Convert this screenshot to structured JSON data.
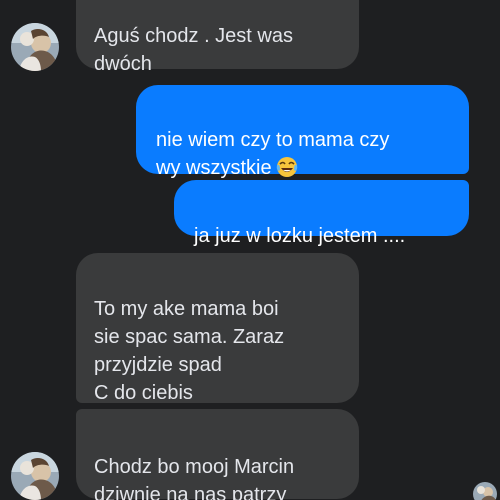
{
  "conversation": {
    "messages": [
      {
        "direction": "incoming",
        "text": "Aguś chodz . Jest was\ndwóch"
      },
      {
        "direction": "outgoing",
        "text": "nie wiem czy to mama czy\nwy wszystkie",
        "emoji": "tears-of-joy-emoji"
      },
      {
        "direction": "outgoing",
        "text": "ja juz w lozku  jestem ...."
      },
      {
        "direction": "incoming",
        "text": "To my ake mama boi\nsie spac sama. Zaraz\nprzyjdzie spad\nC do ciebis"
      },
      {
        "direction": "incoming",
        "text": "Chodz bo mooj Marcin\ndziwnie na nas patrzy"
      }
    ]
  },
  "colors": {
    "background": "#1e1f21",
    "incoming_bubble": "#3a3b3c",
    "outgoing_bubble": "#0a7cff",
    "incoming_text": "#e4e6eb",
    "outgoing_text": "#ffffff"
  },
  "icons": {
    "contact_avatar": "contact-avatar-photo",
    "read_receipt": "read-receipt-avatar"
  }
}
